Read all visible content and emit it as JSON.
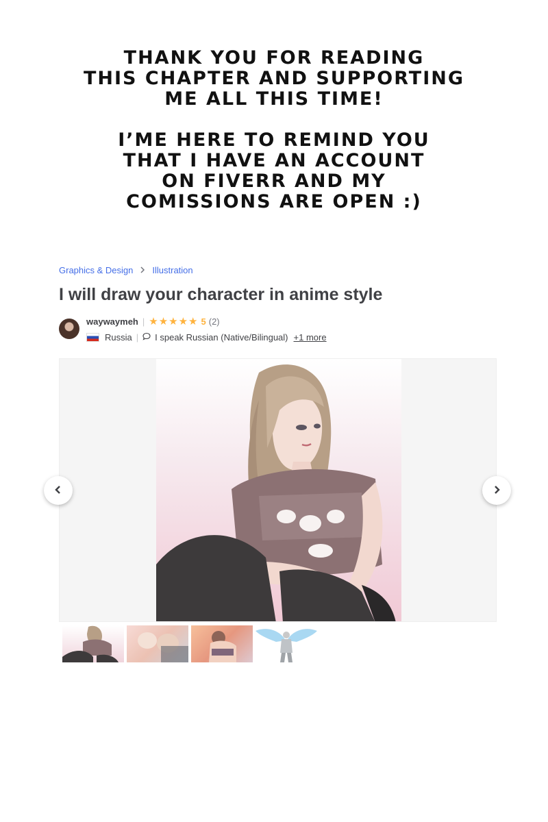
{
  "note": {
    "paragraph1": "Thank you for reading\nthis chapter and supporting\nme all this time!",
    "paragraph2": "I’me here to remind you\nthat I have an account\non fiverr and my\ncomissions are open :)"
  },
  "breadcrumb": {
    "items": [
      "Graphics & Design",
      "Illustration"
    ],
    "separator_icon": "chevron-right-icon"
  },
  "gig": {
    "title": "I will draw your character in anime style"
  },
  "seller": {
    "username": "waywaymeh",
    "stars": "★★★★★",
    "rating": "5",
    "review_count": "(2)",
    "country": "Russia",
    "language": "I speak Russian (Native/Bilingual)",
    "more_languages": "+1 more"
  },
  "gallery": {
    "prev_icon": "‹",
    "next_icon": "›"
  },
  "colors": {
    "link": "#446ee7",
    "star": "#ffb33e",
    "text": "#404145"
  }
}
